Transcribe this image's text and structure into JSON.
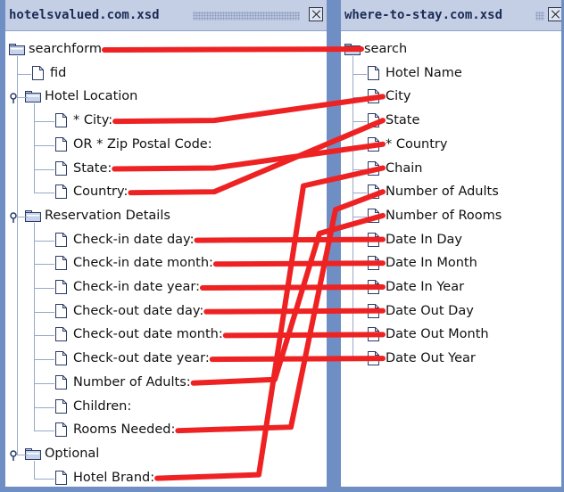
{
  "left_panel": {
    "title": "hotelsvalued.com.xsd",
    "root": "searchform",
    "items": [
      {
        "label": "fid"
      },
      {
        "label": "Hotel Location",
        "group": true
      },
      {
        "label": "* City:"
      },
      {
        "label": "OR * Zip Postal Code:"
      },
      {
        "label": "State:"
      },
      {
        "label": "Country:"
      },
      {
        "label": "Reservation Details",
        "group": true
      },
      {
        "label": "Check-in date day:"
      },
      {
        "label": "Check-in date month:"
      },
      {
        "label": "Check-in date year:"
      },
      {
        "label": "Check-out date day:"
      },
      {
        "label": "Check-out date month:"
      },
      {
        "label": "Check-out date year:"
      },
      {
        "label": "Number of Adults:"
      },
      {
        "label": "Children:"
      },
      {
        "label": "Rooms Needed:"
      },
      {
        "label": "Optional",
        "group": true
      },
      {
        "label": "Hotel Brand:"
      }
    ]
  },
  "right_panel": {
    "title": "where-to-stay.com.xsd",
    "root": "search",
    "items": [
      {
        "label": "Hotel Name"
      },
      {
        "label": "City"
      },
      {
        "label": "State"
      },
      {
        "label": "* Country"
      },
      {
        "label": "Chain"
      },
      {
        "label": "Number of Adults"
      },
      {
        "label": "Number of Rooms"
      },
      {
        "label": "Date In Day"
      },
      {
        "label": "Date In Month"
      },
      {
        "label": "Date In Year"
      },
      {
        "label": "Date Out Day"
      },
      {
        "label": "Date Out Month"
      },
      {
        "label": "Date Out Year"
      }
    ]
  },
  "mappings": [
    [
      "searchform",
      "search"
    ],
    [
      "* City:",
      "City"
    ],
    [
      "State:",
      "* Country"
    ],
    [
      "Country:",
      "State"
    ],
    [
      "Check-in date day:",
      "Date In Day"
    ],
    [
      "Check-in date month:",
      "Date In Month"
    ],
    [
      "Check-in date year:",
      "Date In Year"
    ],
    [
      "Check-out date day:",
      "Date Out Day"
    ],
    [
      "Check-out date month:",
      "Date Out Month"
    ],
    [
      "Check-out date year:",
      "Date Out Year"
    ],
    [
      "Number of Adults:",
      "Number of Rooms"
    ],
    [
      "Rooms Needed:",
      "Number of Adults"
    ],
    [
      "Hotel Brand:",
      "Chain"
    ]
  ],
  "colors": {
    "mapping_line": "#ee2222",
    "panel_border": "#6f8fc4",
    "titlebar": "#c4cfe6"
  }
}
